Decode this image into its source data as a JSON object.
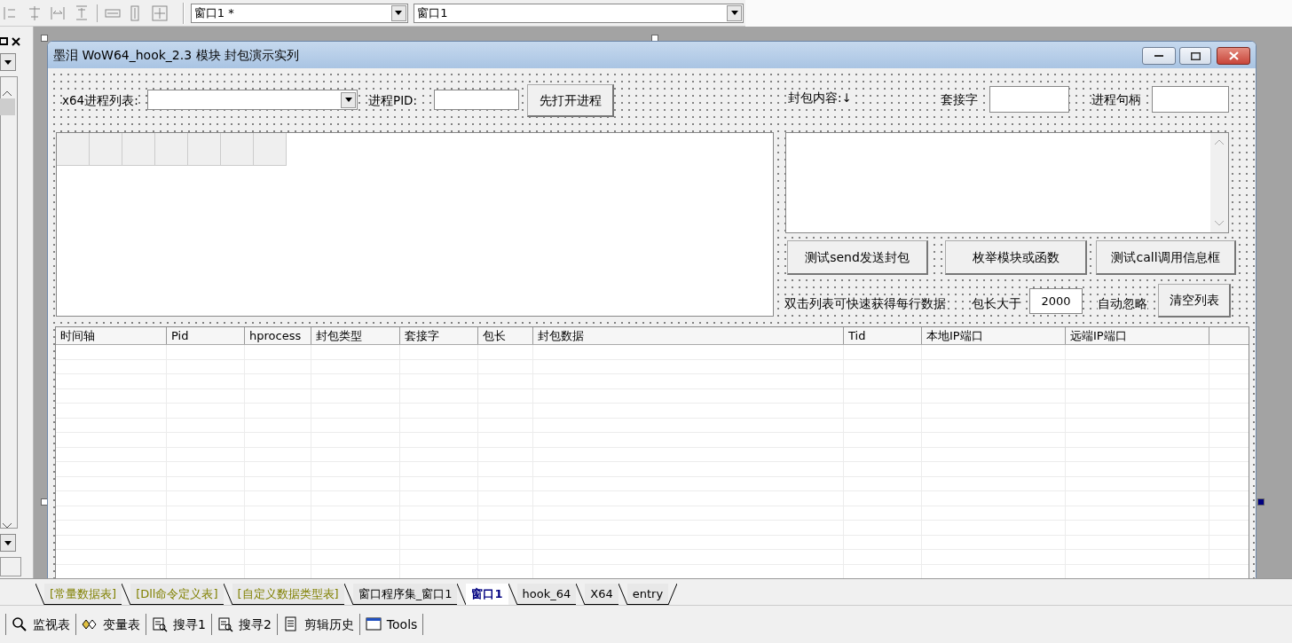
{
  "toolbar": {
    "combos": [
      {
        "value": "窗口1 *"
      },
      {
        "value": "窗口1"
      }
    ]
  },
  "form": {
    "title": "墨泪 WoW64_hook_2.3 模块 封包演示实列",
    "controls": [
      {
        "kind": "label",
        "text": "x64进程列表:"
      },
      {
        "kind": "combo"
      },
      {
        "kind": "label",
        "text": "进程PID:"
      },
      {
        "kind": "input"
      },
      {
        "kind": "button",
        "text": "先打开进程"
      },
      {
        "kind": "label",
        "text": "封包内容:↓"
      },
      {
        "kind": "label",
        "text": "套接字"
      },
      {
        "kind": "input"
      },
      {
        "kind": "label",
        "text": "进程句柄"
      },
      {
        "kind": "input"
      },
      {
        "kind": "grid"
      },
      {
        "kind": "textarea"
      },
      {
        "kind": "button",
        "text": "测试send发送封包"
      },
      {
        "kind": "button",
        "text": "枚举模块或函数"
      },
      {
        "kind": "button",
        "text": "测试call调用信息框"
      },
      {
        "kind": "label",
        "text": "双击列表可快速获得每行数据"
      },
      {
        "kind": "label",
        "text": "包长大于"
      },
      {
        "kind": "input",
        "value": "2000"
      },
      {
        "kind": "label",
        "text": "自动忽略"
      },
      {
        "kind": "button",
        "text": "清空列表"
      }
    ],
    "table": {
      "columns": [
        "时间轴",
        "Pid",
        "hprocess",
        "封包类型",
        "套接字",
        "包长",
        "封包数据",
        "Tid",
        "本地IP端口",
        "远端IP端口"
      ]
    }
  },
  "bottom_tabs": [
    {
      "label": "[常量数据表]",
      "selected": false,
      "color": "#808000"
    },
    {
      "label": "[Dll命令定义表]",
      "selected": false,
      "color": "#808000"
    },
    {
      "label": "[自定义数据类型表]",
      "selected": false,
      "color": "#808000"
    },
    {
      "label": "窗口程序集_窗口1",
      "selected": false,
      "color": "#000000"
    },
    {
      "label": "窗口1",
      "selected": true,
      "color": "#000080"
    },
    {
      "label": "hook_64",
      "selected": false,
      "color": "#000000"
    },
    {
      "label": "X64",
      "selected": false,
      "color": "#000000"
    },
    {
      "label": "entry",
      "selected": false,
      "color": "#000000"
    }
  ],
  "bottom_toolbar": [
    {
      "label": "监视表"
    },
    {
      "label": "变量表"
    },
    {
      "label": "搜寻1"
    },
    {
      "label": "搜寻2"
    },
    {
      "label": "剪辑历史"
    },
    {
      "label": "Tools"
    }
  ]
}
